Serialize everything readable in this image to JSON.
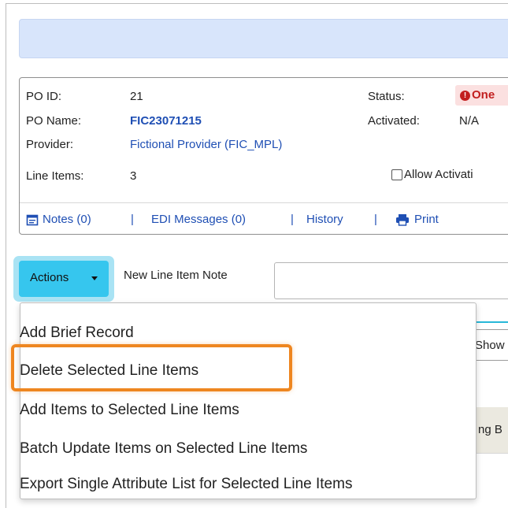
{
  "po": {
    "id_label": "PO ID:",
    "id_value": "21",
    "name_label": "PO Name:",
    "name_value": "FIC23071215",
    "provider_label": "Provider:",
    "provider_value": "Fictional Provider (FIC_MPL)",
    "line_items_label": "Line Items:",
    "line_items_value": "3",
    "status_label": "Status:",
    "status_value": "One",
    "activated_label": "Activated:",
    "activated_value": "N/A",
    "allow_activation_label": "Allow Activati"
  },
  "toolbar": {
    "notes": "Notes (0)",
    "edi": "EDI Messages (0)",
    "history": "History",
    "print": "Print",
    "separator": "|"
  },
  "actions": {
    "button_label": "Actions",
    "note_label": "New Line Item Note"
  },
  "background": {
    "show_label": "Show",
    "header_fragment": "ng B"
  },
  "menu": {
    "items": [
      "Add Brief Record",
      "Delete Selected Line Items",
      "Add Items to Selected Line Items",
      "Batch Update Items on Selected Line Items",
      "Export Single Attribute List for Selected Line Items"
    ],
    "highlighted_index": 1
  },
  "colors": {
    "accent": "#36c6ee",
    "highlight": "#ee8620",
    "link": "#1f4fb4",
    "alert": "#c21f1f",
    "banner": "#d8e5fb"
  },
  "icons": {
    "notes": "calendar-icon",
    "print": "printer-icon",
    "status": "alert-icon",
    "caret": "caret-down-icon"
  }
}
